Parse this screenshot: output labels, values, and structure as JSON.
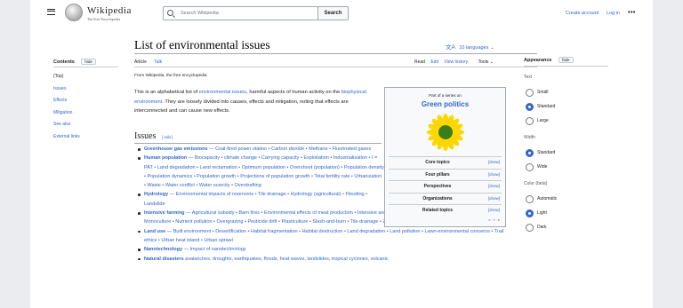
{
  "header": {
    "wordmark": "Wikipedia",
    "tagline": "The Free Encyclopedia",
    "search_placeholder": "Search Wikipedia",
    "search_button": "Search",
    "create_account": "Create account",
    "login": "Log in",
    "more": "•••"
  },
  "article": {
    "title": "List of environmental issues",
    "languages": "10 languages",
    "tabs_left": [
      "Article",
      "Talk"
    ],
    "tabs_right": [
      "Read",
      "Edit",
      "View history",
      "Tools"
    ],
    "from": "From Wikipedia, the free encyclopedia",
    "intro_1": "This is an alphabetical list of ",
    "intro_link_1": "environmental issues",
    "intro_2": ", harmful aspects of human activity on the ",
    "intro_link_2": "biophysical environment",
    "intro_3": ". They are loosely divided into causes, effects and mitigation, noting that effects are interconnected and can cause new effects.",
    "section_title": "Issues",
    "edit": "[ edit ]",
    "issues": [
      {
        "head": "Greenhouse gas emissions",
        "rest": " — Coal-fired power station • Carbon dioxide • Methane • Fluorinated gases"
      },
      {
        "head": "Human population",
        "rest": " — Biocapacity • climate change • Carrying capacity • Exploitation • Industrialisation • I = PAT • Land degradation • Land reclamation • Optimum population • Overshoot (population) • Population density • Population dynamics • Population growth • Projections of population growth • Total fertility rate • Urbanization • Waste • Water conflict • Water scarcity • Overdrafting"
      },
      {
        "head": "Hydrology",
        "rest": " — Environmental impacts of reservoirs • Tile drainage • Hydrology (agricultural) • Flooding • Landslide"
      },
      {
        "head": "Intensive farming",
        "rest": " — Agricultural subsidy • Barn fires • Environmental effects of meat production • Intensive animal farming • Intensive crop farming • Irrigation • Monoculture • Nutrient pollution • Overgrazing • Pesticide drift • Plasticulture • Slash-and-burn • Tile drainage • Zoonosis"
      },
      {
        "head": "Land use",
        "rest": " — Built environment • Desertification • Habitat fragmentation • Habitat destruction • Land degradation • Land pollution • Lawn-environmental concerns • Trail ethics • Urban heat island • Urban sprawl"
      },
      {
        "head": "Nanotechnology",
        "rest": " — Impact of nanotechnology"
      },
      {
        "head": "Natural disasters",
        "rest": " avalanches, droughts, earthquakes, floods, heat waves, landslides, tropical cyclones, volcanic"
      }
    ]
  },
  "toc": {
    "title": "Contents",
    "hide": "hide",
    "items": [
      "(Top)",
      "Issues",
      "Effects",
      "Mitigation",
      "See also",
      "External links"
    ]
  },
  "infobox": {
    "part_of": "Part of a series on",
    "title": "Green politics",
    "rows": [
      "Core topics",
      "Four pillars",
      "Perspectives",
      "Organizations",
      "Related topics"
    ],
    "show": "[show]",
    "vte": "v · t · e"
  },
  "appearance": {
    "title": "Appearance",
    "hide": "hide",
    "text_label": "Text",
    "text_options": [
      "Small",
      "Standard",
      "Large"
    ],
    "text_selected": "Standard",
    "width_label": "Width",
    "width_options": [
      "Standard",
      "Wide"
    ],
    "color_label": "Color (beta)",
    "color_options": [
      "Automatic",
      "Light",
      "Dark"
    ]
  },
  "colors": {
    "link": "#3366cc",
    "sunflower_petal": "#ffd700",
    "sunflower_center": "#3a7d1e"
  }
}
